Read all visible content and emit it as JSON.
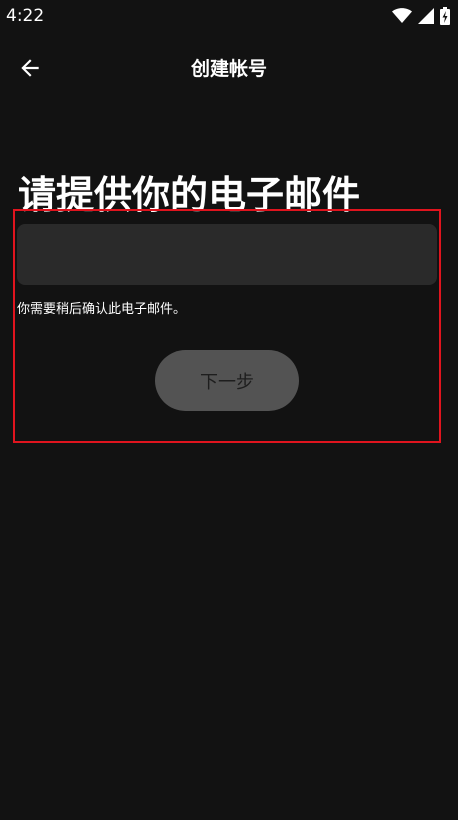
{
  "status_bar": {
    "time": "4:22"
  },
  "app_bar": {
    "title": "创建帐号",
    "back_icon": "arrow-left-icon"
  },
  "heading": "请提供你的电子邮件",
  "email_input": {
    "value": "",
    "placeholder": ""
  },
  "helper_text": "你需要稍后确认此电子邮件。",
  "next_button": {
    "label": "下一步"
  },
  "colors": {
    "background": "#121212",
    "input_background": "#2a2a2a",
    "button_background": "#535353",
    "button_text": "#1e1e1e",
    "highlight_border": "#e0141e"
  }
}
